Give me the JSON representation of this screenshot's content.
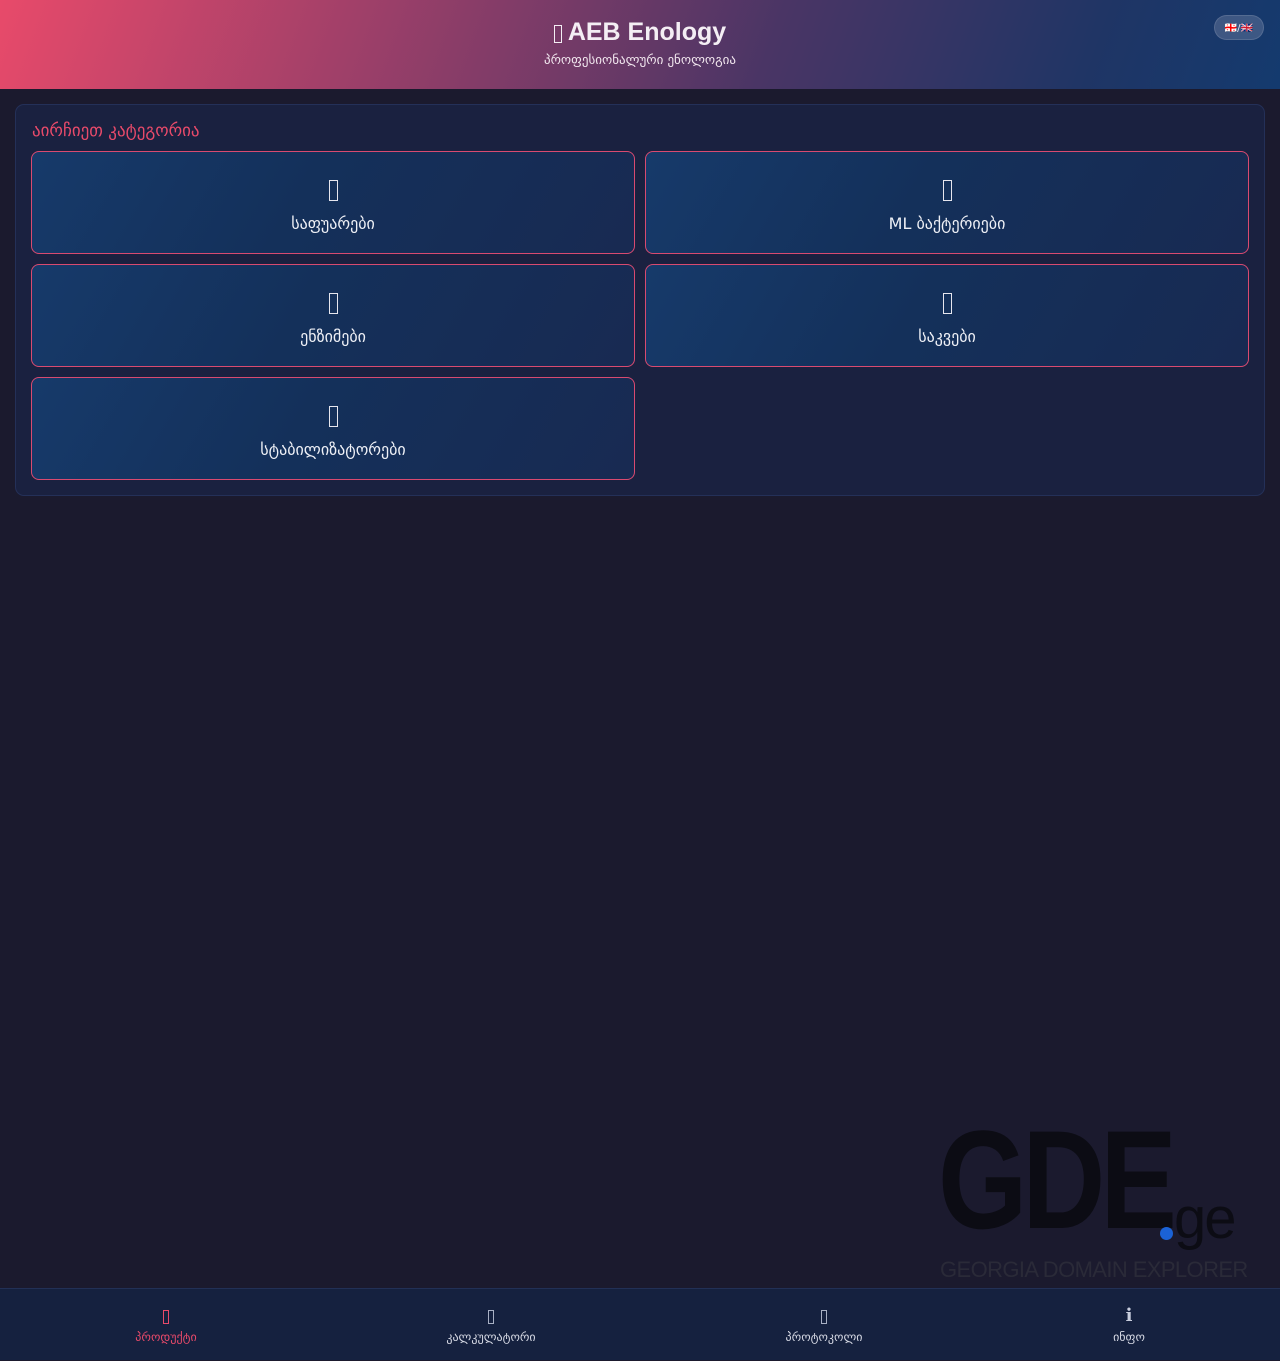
{
  "header": {
    "title": "AEB Enology",
    "subtitle": "პროფესიონალური ენოლოგია",
    "title_icon": "wine-glass-icon",
    "lang_toggle": "🇬🇪/🇬🇧"
  },
  "categories": {
    "title": "აირჩიეთ კატეგორია",
    "items": [
      {
        "label": "საფუარები",
        "icon": "yeast-icon"
      },
      {
        "label": "ML ბაქტერიები",
        "icon": "bacteria-icon"
      },
      {
        "label": "ენზიმები",
        "icon": "enzyme-icon"
      },
      {
        "label": "საკვები",
        "icon": "nutrient-icon"
      },
      {
        "label": "სტაბილიზატორები",
        "icon": "stabilizer-icon"
      }
    ]
  },
  "watermark": {
    "brand": "GDE",
    "tld": "ge",
    "tagline": "GEORGIA DOMAIN EXPLORER"
  },
  "nav": {
    "items": [
      {
        "label": "პროდუქტი",
        "icon": "products-icon",
        "active": true
      },
      {
        "label": "კალკულატორი",
        "icon": "calculator-icon",
        "active": false
      },
      {
        "label": "პროტოკოლი",
        "icon": "protocol-icon",
        "active": false
      },
      {
        "label": "ინფო",
        "icon": "info-icon",
        "active": false
      }
    ]
  },
  "colors": {
    "accent": "#e84a6a",
    "background": "#1b1a2e",
    "card": "#14305a",
    "nav": "#15213f"
  }
}
